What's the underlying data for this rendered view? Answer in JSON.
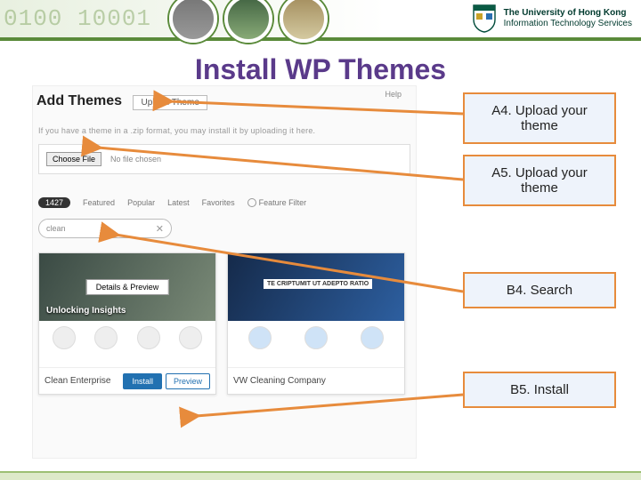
{
  "header": {
    "binary_text": "0100    10001",
    "org_line1": "The University of Hong Kong",
    "org_line2": "Information Technology Services"
  },
  "title": "Install WP Themes",
  "wp": {
    "add_themes_label": "Add Themes",
    "upload_theme_btn": "Upload Theme",
    "help_label": "Help",
    "zip_instruction": "If you have a theme in a .zip format, you may install it by uploading it here.",
    "choose_file_btn": "Choose File",
    "no_file_text": "No file chosen",
    "theme_count": "1427",
    "tabs": [
      "Featured",
      "Popular",
      "Latest",
      "Favorites"
    ],
    "feature_filter": "Feature Filter",
    "search_value": "clean",
    "cards": [
      {
        "overlay": "Unlocking Insights",
        "details_btn": "Details & Preview",
        "name": "Clean Enterprise",
        "install": "Install",
        "preview": "Preview"
      },
      {
        "overlay": "TE CRIPTUMIT UT ADEPTO RATIO",
        "name": "VW Cleaning Company"
      }
    ]
  },
  "callouts": {
    "a4": "A4. Upload your theme",
    "a5": "A5. Upload your theme",
    "b4": "B4. Search",
    "b5": "B5. Install"
  }
}
